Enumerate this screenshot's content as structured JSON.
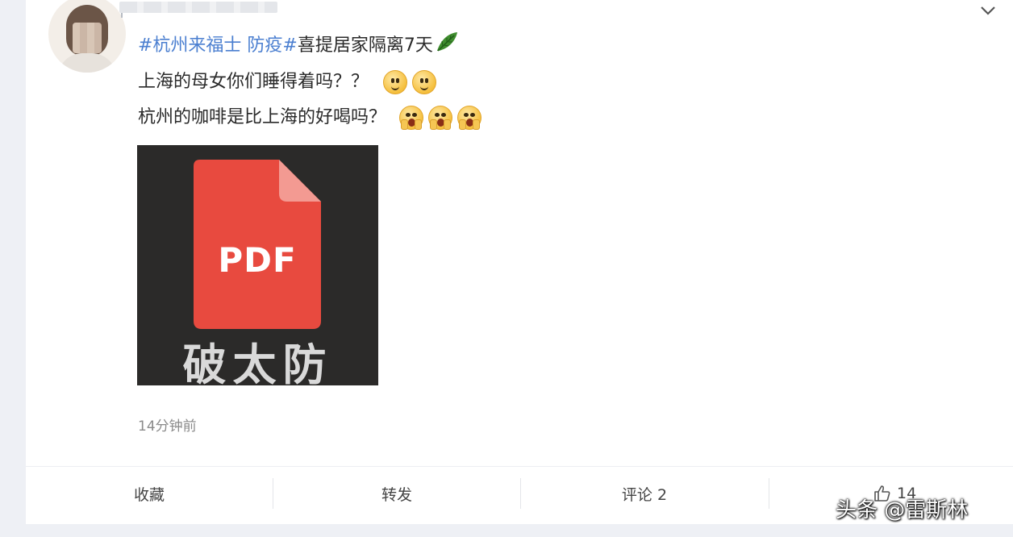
{
  "post": {
    "hashtag1": "#杭州来福士 防疫#",
    "line1_rest": "喜提居家隔离7天",
    "line2": "上海的母女你们睡得着吗？？",
    "line3": "杭州的咖啡是比上海的好喝吗？",
    "emojis_line2": [
      "smile-emoji",
      "smile-emoji"
    ],
    "emojis_line3": [
      "shock-emoji",
      "shock-emoji",
      "shock-emoji"
    ],
    "timestamp": "14分钟前"
  },
  "media": {
    "icon_name": "pdf-file-icon",
    "icon_label": "PDF",
    "caption": "破太防",
    "icon_color": "#e84a3f",
    "background_color": "#2b2a29"
  },
  "actions": {
    "favorite_label": "收藏",
    "repost_label": "转发",
    "comment_label": "评论 2",
    "like_count": "14"
  },
  "watermark": "头条 @雷斯林",
  "colors": {
    "hashtag": "#4b7fd0",
    "text": "#2a2a2a",
    "muted": "#8a8a8a"
  }
}
